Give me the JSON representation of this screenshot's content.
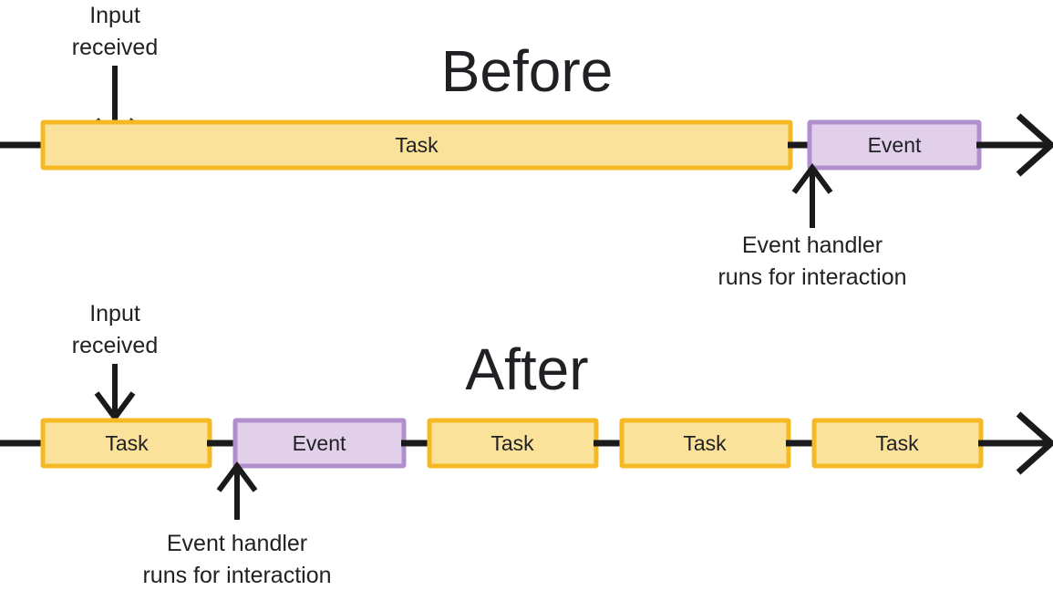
{
  "page": {
    "background_color": "#ffffff",
    "text_color": "#202124"
  },
  "palette": {
    "task_fill": "#fbe29a",
    "task_stroke": "#f5b926",
    "event_fill": "#e2d0ea",
    "event_stroke": "#b18fcd",
    "line_color": "#1a1a1a"
  },
  "before": {
    "title": "Before",
    "input_annotation_line1": "Input",
    "input_annotation_line2": "received",
    "handler_annotation_line1": "Event handler",
    "handler_annotation_line2": "runs for interaction",
    "blocks": [
      {
        "label": "Task",
        "kind": "task"
      },
      {
        "label": "Event",
        "kind": "event"
      }
    ]
  },
  "after": {
    "title": "After",
    "input_annotation_line1": "Input",
    "input_annotation_line2": "received",
    "handler_annotation_line1": "Event handler",
    "handler_annotation_line2": "runs for interaction",
    "blocks": [
      {
        "label": "Task",
        "kind": "task"
      },
      {
        "label": "Event",
        "kind": "event"
      },
      {
        "label": "Task",
        "kind": "task"
      },
      {
        "label": "Task",
        "kind": "task"
      },
      {
        "label": "Task",
        "kind": "task"
      }
    ]
  }
}
